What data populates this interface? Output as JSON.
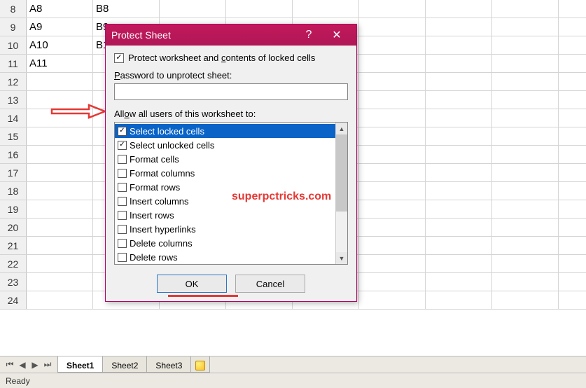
{
  "rows": [
    {
      "num": "8",
      "a": "A8",
      "b": "B8"
    },
    {
      "num": "9",
      "a": "A9",
      "b": "B9"
    },
    {
      "num": "10",
      "a": "A10",
      "b": "B1"
    },
    {
      "num": "11",
      "a": "A11",
      "b": ""
    },
    {
      "num": "12",
      "a": "",
      "b": ""
    },
    {
      "num": "13",
      "a": "",
      "b": ""
    },
    {
      "num": "14",
      "a": "",
      "b": ""
    },
    {
      "num": "15",
      "a": "",
      "b": ""
    },
    {
      "num": "16",
      "a": "",
      "b": ""
    },
    {
      "num": "17",
      "a": "",
      "b": ""
    },
    {
      "num": "18",
      "a": "",
      "b": ""
    },
    {
      "num": "19",
      "a": "",
      "b": ""
    },
    {
      "num": "20",
      "a": "",
      "b": ""
    },
    {
      "num": "21",
      "a": "",
      "b": ""
    },
    {
      "num": "22",
      "a": "",
      "b": ""
    },
    {
      "num": "23",
      "a": "",
      "b": ""
    },
    {
      "num": "24",
      "a": "",
      "b": ""
    }
  ],
  "dialog": {
    "title": "Protect Sheet",
    "protect_label_pre": "Protect worksheet and ",
    "protect_label_u": "c",
    "protect_label_post": "ontents of locked cells",
    "password_label_u": "P",
    "password_label_post": "assword to unprotect sheet:",
    "password_value": "",
    "allow_label_pre": "All",
    "allow_label_u": "o",
    "allow_label_post": "w all users of this worksheet to:",
    "permissions": [
      {
        "label": "Select locked cells",
        "checked": true,
        "selected": true
      },
      {
        "label": "Select unlocked cells",
        "checked": true,
        "selected": false
      },
      {
        "label": "Format cells",
        "checked": false,
        "selected": false
      },
      {
        "label": "Format columns",
        "checked": false,
        "selected": false
      },
      {
        "label": "Format rows",
        "checked": false,
        "selected": false
      },
      {
        "label": "Insert columns",
        "checked": false,
        "selected": false
      },
      {
        "label": "Insert rows",
        "checked": false,
        "selected": false
      },
      {
        "label": "Insert hyperlinks",
        "checked": false,
        "selected": false
      },
      {
        "label": "Delete columns",
        "checked": false,
        "selected": false
      },
      {
        "label": "Delete rows",
        "checked": false,
        "selected": false
      }
    ],
    "ok": "OK",
    "cancel": "Cancel"
  },
  "watermark": "superpctricks.com",
  "tabs": {
    "nav": {
      "first": "⏮",
      "prev": "◀",
      "next": "▶",
      "last": "⏭"
    },
    "items": [
      {
        "label": "Sheet1",
        "active": true
      },
      {
        "label": "Sheet2",
        "active": false
      },
      {
        "label": "Sheet3",
        "active": false
      }
    ]
  },
  "statusbar": {
    "text": "Ready"
  }
}
